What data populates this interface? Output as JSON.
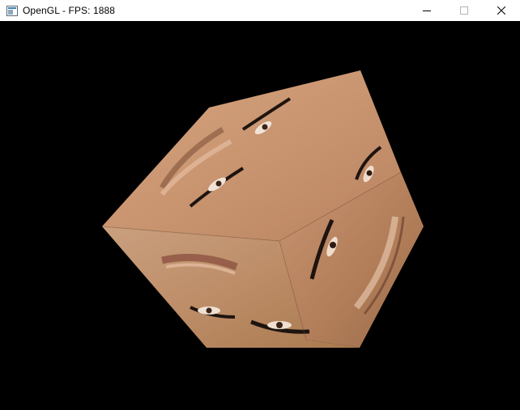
{
  "window": {
    "title": "OpenGL - FPS: 1888",
    "app_icon": "opengl-window-icon",
    "controls": {
      "minimize_icon": "minimize-icon",
      "maximize_icon": "maximize-icon",
      "close_icon": "close-icon"
    }
  },
  "viewport": {
    "background_color": "#000000",
    "scene": "rotating-textured-cube",
    "texture": "face-photo-texture",
    "skin_light": "#d8a984",
    "skin_mid": "#c28d66",
    "skin_dark": "#9b6a47"
  }
}
